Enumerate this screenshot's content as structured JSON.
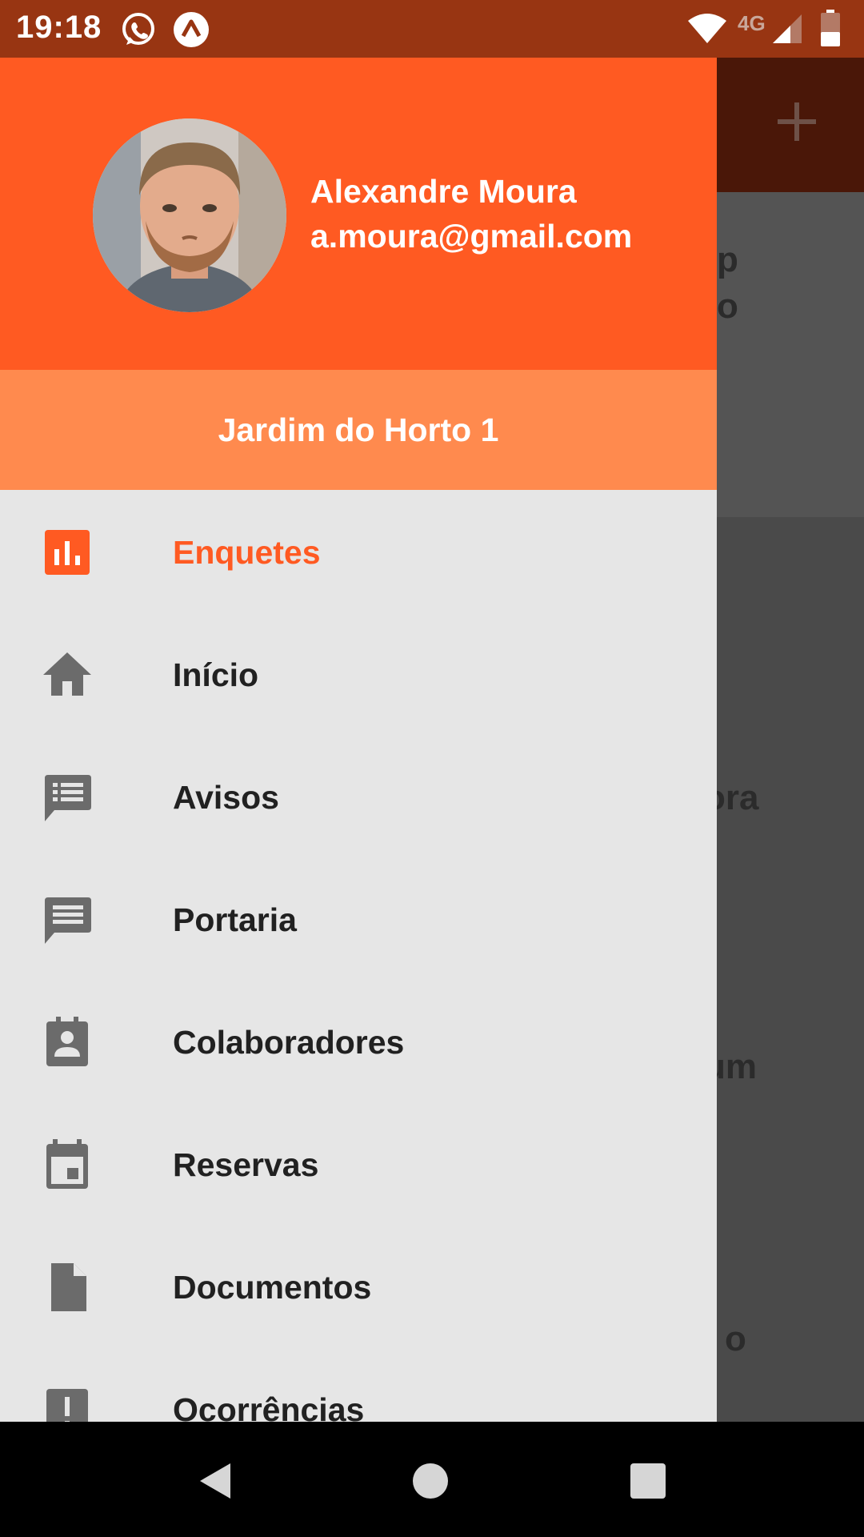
{
  "status_bar": {
    "time": "19:18",
    "network": "4G",
    "icons": [
      "whatsapp-icon",
      "arrow-up-icon",
      "wifi-icon",
      "signal-icon",
      "battery-icon"
    ]
  },
  "background_app": {
    "fragments": [
      "p",
      "o",
      "ora",
      "um",
      "o"
    ]
  },
  "drawer": {
    "user": {
      "name": "Alexandre Moura",
      "email": "a.moura@gmail.com"
    },
    "condo": "Jardim do Horto 1",
    "menu": [
      {
        "label": "Enquetes",
        "icon": "poll-icon",
        "active": true
      },
      {
        "label": "Início",
        "icon": "home-icon",
        "active": false
      },
      {
        "label": "Avisos",
        "icon": "notices-icon",
        "active": false
      },
      {
        "label": "Portaria",
        "icon": "message-icon",
        "active": false
      },
      {
        "label": "Colaboradores",
        "icon": "contact-badge-icon",
        "active": false
      },
      {
        "label": "Reservas",
        "icon": "calendar-icon",
        "active": false
      },
      {
        "label": "Documentos",
        "icon": "document-icon",
        "active": false
      },
      {
        "label": "Ocorrências",
        "icon": "alert-icon",
        "active": false
      }
    ]
  },
  "colors": {
    "accent": "#ff5a22",
    "accent_light": "#ff8a4e",
    "status_bar": "#983512",
    "icon_gray": "#6b6b6b"
  }
}
